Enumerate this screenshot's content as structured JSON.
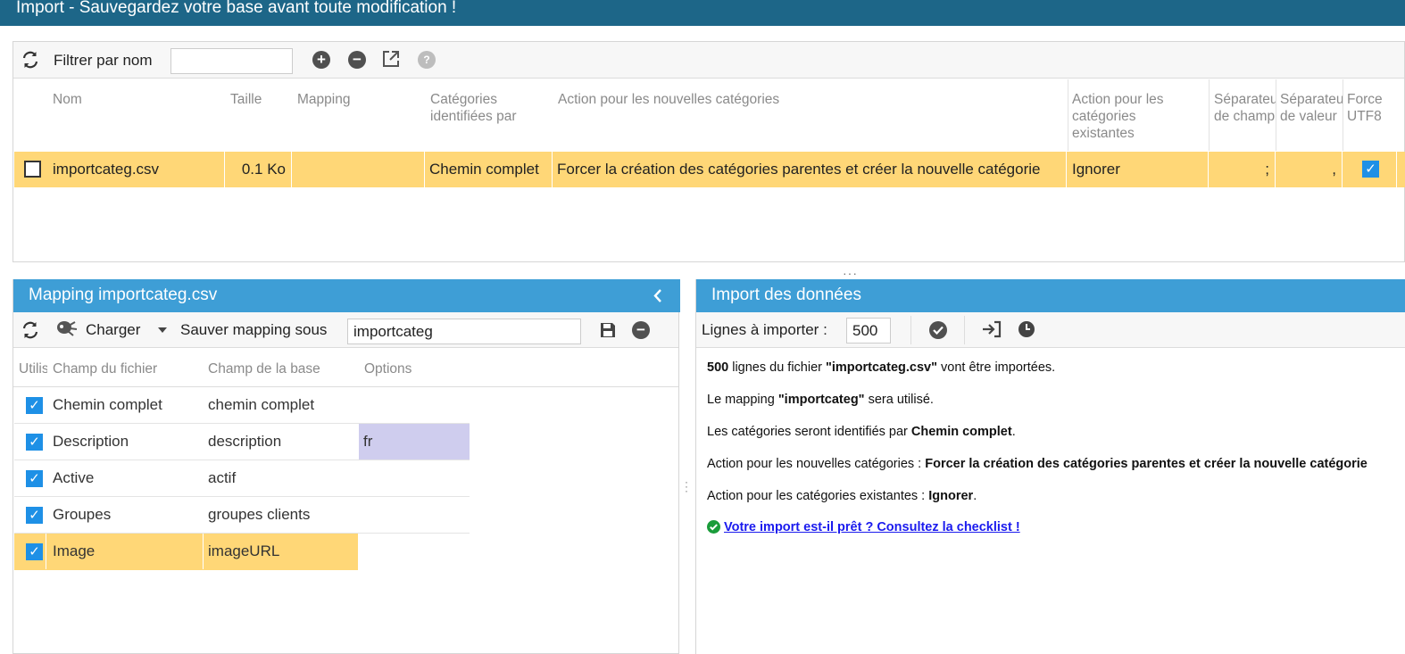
{
  "window": {
    "title": "Import - Sauvegardez votre base avant toute modification !"
  },
  "files": {
    "toolbar": {
      "filter_label": "Filtrer par nom",
      "filter_value": ""
    },
    "columns": [
      "Nom",
      "Taille",
      "Mapping",
      "Catégories identifiées par",
      "Action pour les nouvelles catégories",
      "Action pour les catégories existantes",
      "Séparateur de champ",
      "Séparateur de valeur",
      "Force UTF8"
    ],
    "row": {
      "checked": false,
      "name": "importcateg.csv",
      "size": "0.1 Ko",
      "mapping": "",
      "identified_by": "Chemin complet",
      "new_action": "Forcer la création des catégories parentes et créer la nouvelle catégorie",
      "existing_action": "Ignorer",
      "field_sep": ";",
      "value_sep": ",",
      "force_utf8": true
    }
  },
  "mapping": {
    "title": "Mapping importcateg.csv",
    "toolbar": {
      "load_label": "Charger",
      "save_as_label": "Sauver mapping sous",
      "mapping_name": "importcateg"
    },
    "columns": [
      "Utilisé",
      "Champ du fichier",
      "Champ de la base",
      "Options"
    ],
    "rows": [
      {
        "used": true,
        "file_field": "Chemin complet",
        "db_field": "chemin complet",
        "options": "",
        "highlight": false
      },
      {
        "used": true,
        "file_field": "Description",
        "db_field": "description",
        "options": "fr",
        "highlight": false
      },
      {
        "used": true,
        "file_field": "Active",
        "db_field": "actif",
        "options": "",
        "highlight": false
      },
      {
        "used": true,
        "file_field": "Groupes",
        "db_field": "groupes clients",
        "options": "",
        "highlight": false
      },
      {
        "used": true,
        "file_field": "Image",
        "db_field": "imageURL",
        "options": "",
        "highlight": true
      }
    ]
  },
  "import": {
    "title": "Import des données",
    "lines_label": "Lignes à importer :",
    "lines_value": "500",
    "summary": {
      "line1": {
        "count": "500",
        "mid": " lignes du fichier ",
        "file": "\"importcateg.csv\"",
        "end": " vont être importées."
      },
      "line2": {
        "start": "Le mapping ",
        "name": "\"importcateg\"",
        "end": " sera utilisé."
      },
      "line3": {
        "start": "Les catégories seront identifiés par ",
        "value": "Chemin complet",
        "end": "."
      },
      "line4": {
        "start": "Action pour les nouvelles catégories : ",
        "value": "Forcer la création des catégories parentes et créer la nouvelle catégorie"
      },
      "line5": {
        "start": "Action pour les catégories existantes : ",
        "value": "Ignorer",
        "end": "."
      },
      "checklist_link": "Votre import est-il prêt ? Consultez la checklist !"
    }
  },
  "colors": {
    "title_bar": "#1d6688",
    "panel_header": "#3e9ed6",
    "selected_row": "#ffd777",
    "option_cell": "#cfcdee",
    "checkbox": "#1e90e6",
    "link": "#1a1aee",
    "ok_green": "#1a9c3a"
  }
}
